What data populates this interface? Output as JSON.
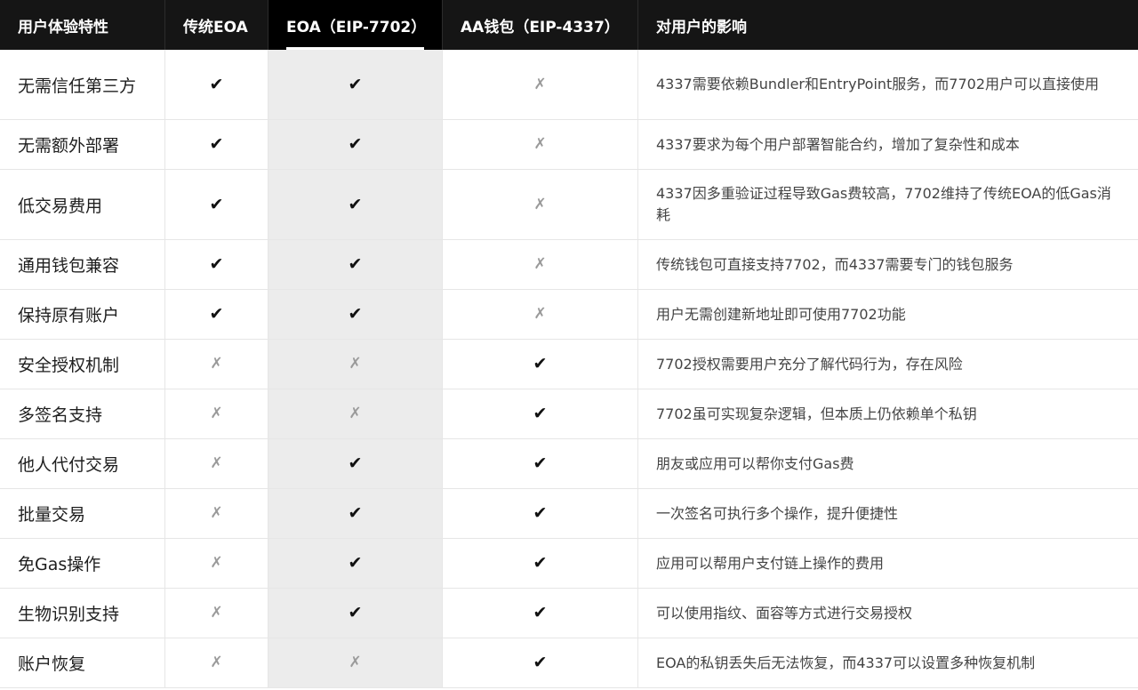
{
  "table": {
    "headers": [
      "用户体验特性",
      "传统EOA",
      "EOA（EIP-7702）",
      "AA钱包（EIP-4337）",
      "对用户的影响"
    ],
    "symbols": {
      "yes": "✔",
      "no": "✗"
    },
    "rows": [
      {
        "feature": "无需信任第三方",
        "eoa": "✔",
        "eip7702": "✔",
        "eip4337": "✗",
        "impact": "4337需要依赖Bundler和EntryPoint服务，而7702用户可以直接使用"
      },
      {
        "feature": "无需额外部署",
        "eoa": "✔",
        "eip7702": "✔",
        "eip4337": "✗",
        "impact": "4337要求为每个用户部署智能合约，增加了复杂性和成本"
      },
      {
        "feature": "低交易费用",
        "eoa": "✔",
        "eip7702": "✔",
        "eip4337": "✗",
        "impact": "4337因多重验证过程导致Gas费较高，7702维持了传统EOA的低Gas消耗"
      },
      {
        "feature": "通用钱包兼容",
        "eoa": "✔",
        "eip7702": "✔",
        "eip4337": "✗",
        "impact": "传统钱包可直接支持7702，而4337需要专门的钱包服务"
      },
      {
        "feature": "保持原有账户",
        "eoa": "✔",
        "eip7702": "✔",
        "eip4337": "✗",
        "impact": "用户无需创建新地址即可使用7702功能"
      },
      {
        "feature": "安全授权机制",
        "eoa": "✗",
        "eip7702": "✗",
        "eip4337": "✔",
        "impact": "7702授权需要用户充分了解代码行为，存在风险"
      },
      {
        "feature": "多签名支持",
        "eoa": "✗",
        "eip7702": "✗",
        "eip4337": "✔",
        "impact": "7702虽可实现复杂逻辑，但本质上仍依赖单个私钥"
      },
      {
        "feature": "他人代付交易",
        "eoa": "✗",
        "eip7702": "✔",
        "eip4337": "✔",
        "impact": "朋友或应用可以帮你支付Gas费"
      },
      {
        "feature": "批量交易",
        "eoa": "✗",
        "eip7702": "✔",
        "eip4337": "✔",
        "impact": "一次签名可执行多个操作，提升便捷性"
      },
      {
        "feature": "免Gas操作",
        "eoa": "✗",
        "eip7702": "✔",
        "eip4337": "✔",
        "impact": "应用可以帮用户支付链上操作的费用"
      },
      {
        "feature": "生物识别支持",
        "eoa": "✗",
        "eip7702": "✔",
        "eip4337": "✔",
        "impact": "可以使用指纹、面容等方式进行交易授权"
      },
      {
        "feature": "账户恢复",
        "eoa": "✗",
        "eip7702": "✗",
        "eip4337": "✔",
        "impact": "EOA的私钥丢失后无法恢复，而4337可以设置多种恢复机制"
      }
    ]
  }
}
